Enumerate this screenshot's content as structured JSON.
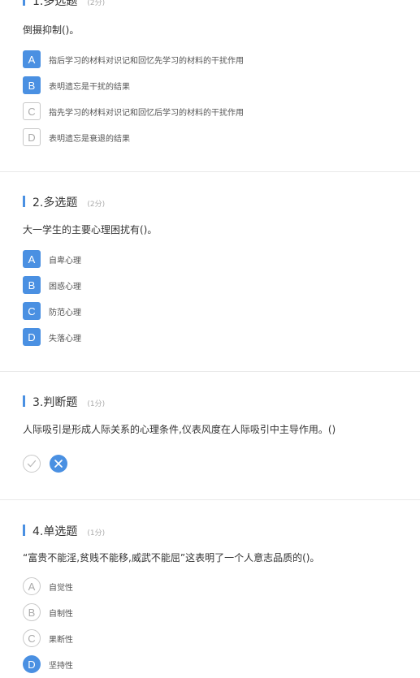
{
  "q1": {
    "title": "1.多选题",
    "score": "(2分)",
    "stem": "倒摄抑制()。",
    "options": [
      {
        "letter": "A",
        "text": "指后学习的材料对识记和回忆先学习的材料的干扰作用",
        "selected": true
      },
      {
        "letter": "B",
        "text": "表明遗忘是干扰的结果",
        "selected": true
      },
      {
        "letter": "C",
        "text": "指先学习的材料对识记和回忆后学习的材料的干扰作用",
        "selected": false
      },
      {
        "letter": "D",
        "text": "表明遗忘是衰退的结果",
        "selected": false
      }
    ]
  },
  "q2": {
    "title": "2.多选题",
    "score": "(2分)",
    "stem": "大一学生的主要心理困扰有()。",
    "options": [
      {
        "letter": "A",
        "text": "自卑心理",
        "selected": true
      },
      {
        "letter": "B",
        "text": "困惑心理",
        "selected": true
      },
      {
        "letter": "C",
        "text": "防范心理",
        "selected": true
      },
      {
        "letter": "D",
        "text": "失落心理",
        "selected": true
      }
    ]
  },
  "q3": {
    "title": "3.判断题",
    "score": "(1分)",
    "stem": "人际吸引是形成人际关系的心理条件,仪表风度在人际吸引中主导作用。()",
    "answer": "false"
  },
  "q4": {
    "title": "4.单选题",
    "score": "(1分)",
    "stem": "“富贵不能淫,贫贱不能移,威武不能屈”这表明了一个人意志品质的()。",
    "options": [
      {
        "letter": "A",
        "text": "自觉性",
        "selected": false
      },
      {
        "letter": "B",
        "text": "自制性",
        "selected": false
      },
      {
        "letter": "C",
        "text": "果断性",
        "selected": false
      },
      {
        "letter": "D",
        "text": "坚持性",
        "selected": true
      }
    ]
  },
  "colors": {
    "accent": "#4a90e2",
    "divider": "#e9e9e9"
  }
}
